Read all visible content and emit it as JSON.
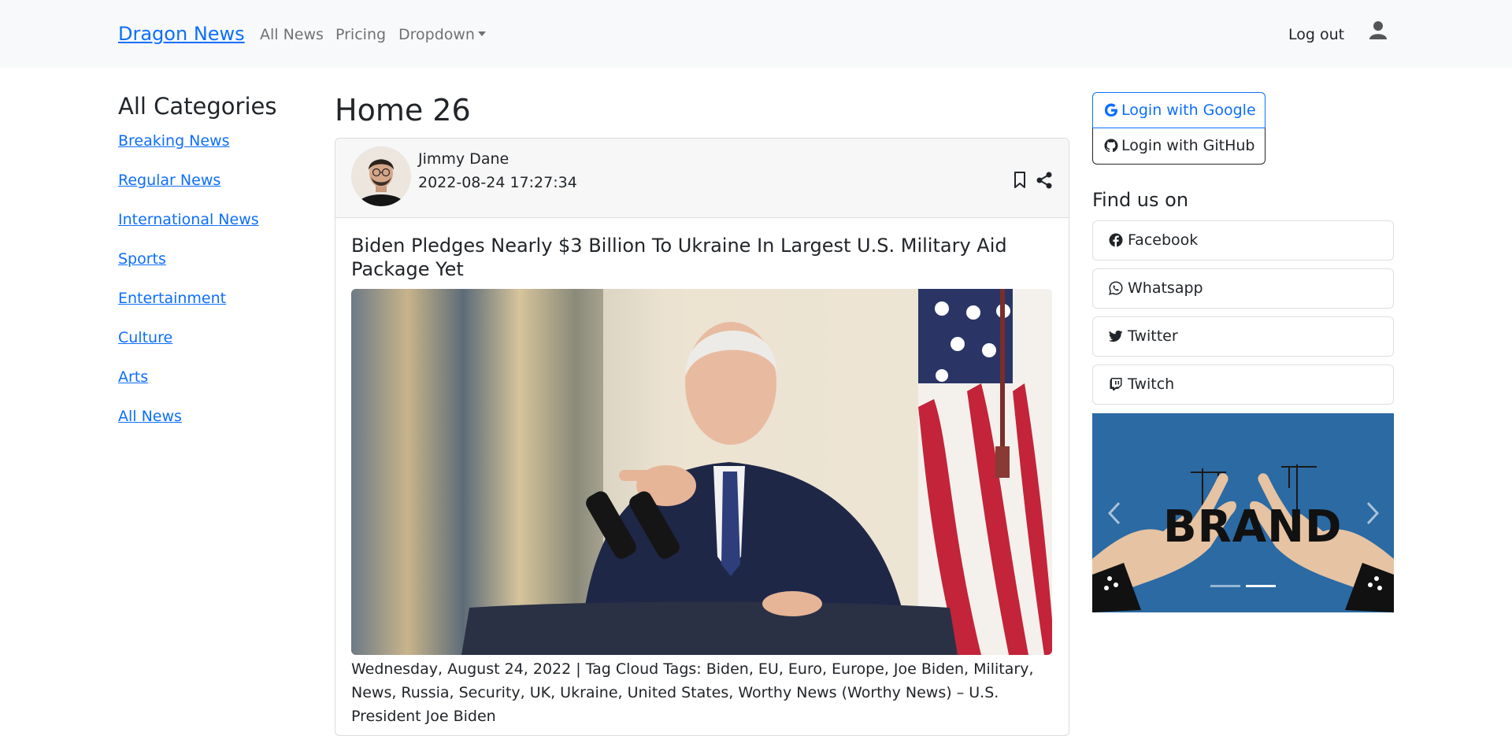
{
  "navbar": {
    "brand": "Dragon News",
    "links": [
      {
        "label": "All News"
      },
      {
        "label": "Pricing"
      },
      {
        "label": "Dropdown"
      }
    ],
    "logout": "Log out",
    "user_icon": "user-icon"
  },
  "sidebar": {
    "title": "All Categories",
    "categories": [
      {
        "label": "Breaking News"
      },
      {
        "label": "Regular News"
      },
      {
        "label": "International News"
      },
      {
        "label": "Sports"
      },
      {
        "label": "Entertainment"
      },
      {
        "label": "Culture"
      },
      {
        "label": "Arts"
      },
      {
        "label": "All News"
      }
    ]
  },
  "main": {
    "title": "Home 26",
    "article": {
      "author": "Jimmy Dane",
      "published": "2022-08-24 17:27:34",
      "headline": "Biden Pledges Nearly $3 Billion To Ukraine In Largest U.S. Military Aid Package Yet",
      "excerpt": "Wednesday, August 24, 2022 | Tag Cloud Tags: Biden, EU, Euro, Europe, Joe Biden, Military, News, Russia, Security, UK, Ukraine, United States, Worthy News (Worthy News) – U.S. President Joe Biden",
      "icons": [
        "bookmark-icon",
        "share-icon"
      ]
    }
  },
  "right": {
    "login_google": "Login with Google",
    "login_github": "Login with GitHub",
    "find_title": "Find us on",
    "social": [
      {
        "label": "Facebook",
        "icon": "facebook-icon"
      },
      {
        "label": "Whatsapp",
        "icon": "whatsapp-icon"
      },
      {
        "label": "Twitter",
        "icon": "twitter-icon"
      },
      {
        "label": "Twitch",
        "icon": "twitch-icon"
      }
    ],
    "carousel": {
      "brand_text": "BRAND",
      "active_slide": 2,
      "slide_count": 2
    }
  },
  "colors": {
    "link": "#0d6efd",
    "navbar_bg": "#f8f9fa",
    "carousel_bg": "#2b6aa3"
  }
}
